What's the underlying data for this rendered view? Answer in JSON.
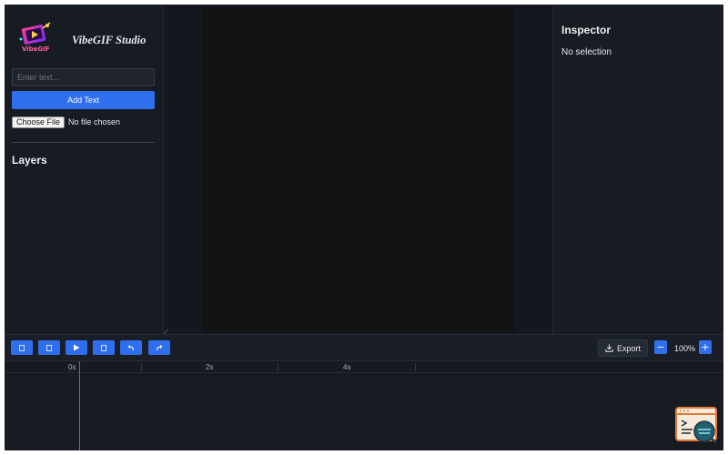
{
  "app": {
    "title": "VibeGIF Studio",
    "logo_text": "VibeGIF"
  },
  "sidebar": {
    "text_input": {
      "placeholder": "Enter text...",
      "value": ""
    },
    "add_text_label": "Add Text",
    "file_button_label": "Choose File",
    "file_status": "No file chosen",
    "layers_title": "Layers"
  },
  "inspector": {
    "title": "Inspector",
    "empty_state": "No selection"
  },
  "toolbar": {
    "buttons": [
      {
        "name": "tool-button-1",
        "icon": "square-icon"
      },
      {
        "name": "tool-button-2",
        "icon": "square-icon"
      },
      {
        "name": "play-button",
        "icon": "play-icon"
      },
      {
        "name": "tool-button-4",
        "icon": "square-icon"
      },
      {
        "name": "undo-button",
        "icon": "undo-icon"
      },
      {
        "name": "redo-button",
        "icon": "redo-icon"
      }
    ],
    "export_label": "Export",
    "export_icon": "download-icon",
    "zoom_out_label": "−",
    "zoom_in_label": "+",
    "zoom_level": "100%"
  },
  "timeline": {
    "ticks": [
      "0s",
      "2s",
      "4s"
    ]
  },
  "colors": {
    "accent": "#2f6fee",
    "playhead": "#e04444",
    "background": "#161a21"
  }
}
